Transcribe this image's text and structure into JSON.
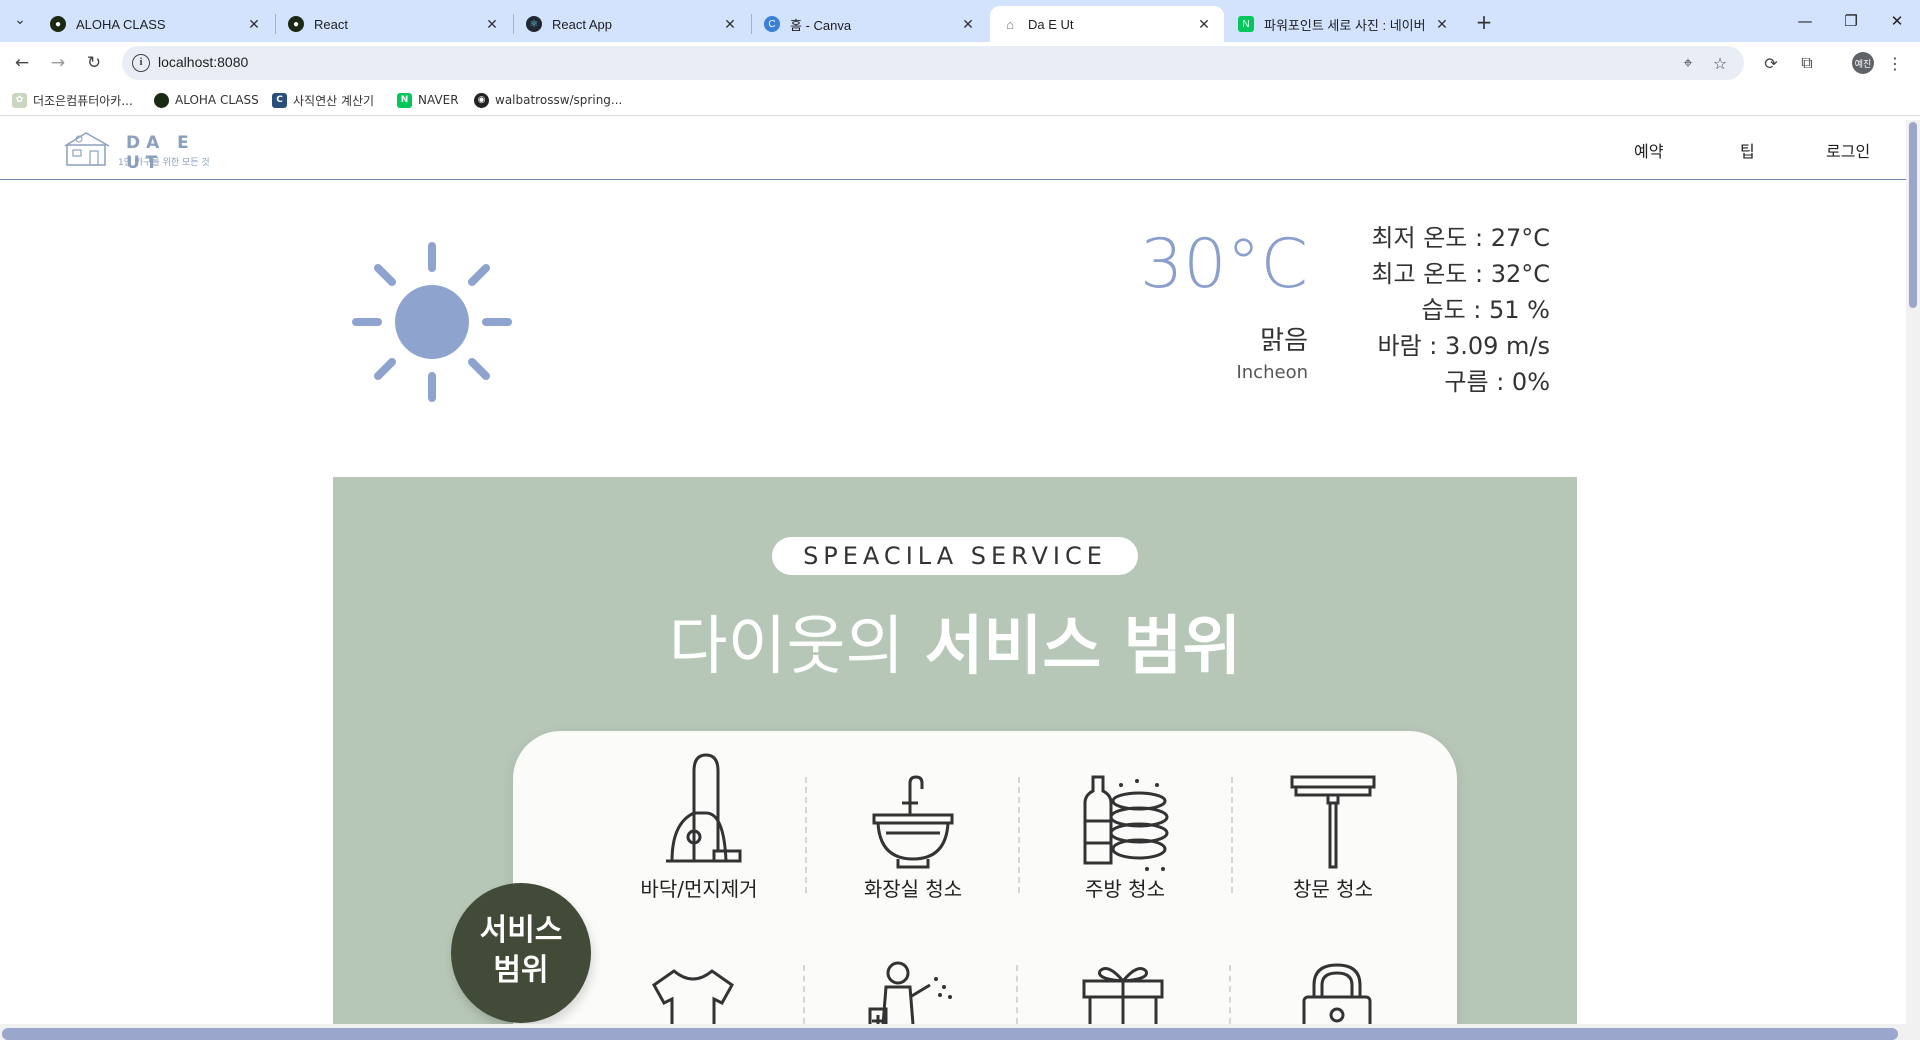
{
  "browser": {
    "tabs": [
      {
        "title": "ALOHA CLASS",
        "favicon": "aloha-icon"
      },
      {
        "title": "React",
        "favicon": "react-icon"
      },
      {
        "title": "React App",
        "favicon": "react-icon"
      },
      {
        "title": "홈 - Canva",
        "favicon": "canva-icon"
      },
      {
        "title": "Da E Ut",
        "favicon": "house-icon"
      },
      {
        "title": "파워포인트 세로 사진 : 네이버",
        "favicon": "naver-icon"
      }
    ],
    "url": "localhost:8080",
    "profile_initial": "예진",
    "bookmarks": [
      {
        "label": "더조은컴퓨터아카..."
      },
      {
        "label": "ALOHA CLASS"
      },
      {
        "label": "사직연산 계산기"
      },
      {
        "label": "NAVER"
      },
      {
        "label": "walbatrossw/spring..."
      }
    ]
  },
  "site": {
    "logo_title": "DA E UT",
    "logo_subtitle": "1인 가구를 위한 모든 것",
    "nav": [
      "예약",
      "팁",
      "로그인"
    ]
  },
  "weather": {
    "temperature": "30°C",
    "condition": "맑음",
    "city": "Incheon",
    "details": [
      "최저 온도 : 27°C",
      "최고 온도 : 32°C",
      "습도 : 51 %",
      "바람 : 3.09 m/s",
      "구름 : 0%"
    ],
    "icon": "sun-icon",
    "icon_color": "#8fa3cf"
  },
  "service": {
    "pill": "SPEACILA  SERVICE",
    "title_light": "다이웃의 ",
    "title_bold": "서비스 범위",
    "badge": "서비스\n범위",
    "badge_line1": "서비스",
    "badge_line2": "범위",
    "items": [
      {
        "label": "바닥/먼지제거",
        "icon": "vacuum-icon"
      },
      {
        "label": "화장실 청소",
        "icon": "sink-icon"
      },
      {
        "label": "주방 청소",
        "icon": "dishes-icon"
      },
      {
        "label": "창문 청소",
        "icon": "squeegee-icon"
      }
    ],
    "row2_icons": [
      "laundry-icon",
      "disinfection-icon",
      "gift-icon",
      "lock-icon"
    ],
    "bg_color": "#b6c6b7",
    "badge_color": "#424a38"
  }
}
